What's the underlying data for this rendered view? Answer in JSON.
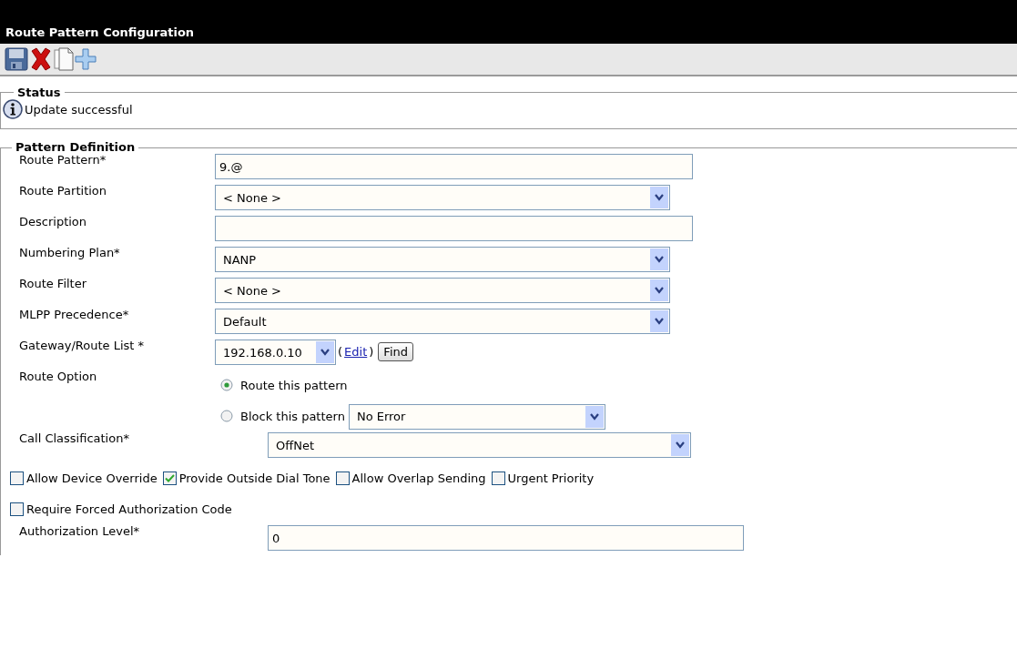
{
  "window": {
    "title": "Route Pattern Configuration"
  },
  "toolbar": [
    {
      "kind": "save"
    },
    {
      "kind": "delete"
    },
    {
      "kind": "copy"
    },
    {
      "kind": "add"
    }
  ],
  "status": {
    "legend": "Status",
    "message": "Update successful"
  },
  "pattern_definition": {
    "legend": "Pattern Definition",
    "rows": [
      {
        "kind": "text",
        "label": "Route Pattern*",
        "value": "9.@"
      },
      {
        "kind": "select",
        "label": "Route Partition",
        "value": "< None >"
      },
      {
        "kind": "text",
        "label": "Description"
      },
      {
        "kind": "select",
        "label": "Numbering Plan*",
        "value": "NANP"
      },
      {
        "kind": "select",
        "label": "Route Filter",
        "value": "< None >"
      },
      {
        "kind": "select",
        "label": "MLPP Precedence*",
        "value": "Default"
      },
      {
        "kind": "gateway",
        "label": "Gateway/Route List *",
        "value": "192.168.0.10",
        "paren_open": "(",
        "link": "Edit",
        "paren_close": ")",
        "button": "Find"
      },
      {
        "kind": "radio",
        "label": "Route Option",
        "options": [
          {
            "label": "Route this pattern",
            "selected": true
          },
          {
            "label": "Block this pattern",
            "selected": false,
            "select_value": "No Error"
          }
        ]
      },
      {
        "kind": "select_wide",
        "label": "Call Classification*",
        "value": "OffNet"
      },
      {
        "kind": "checks",
        "items": [
          {
            "label": "Allow Device Override",
            "checked": false
          },
          {
            "label": "Provide Outside Dial Tone",
            "checked": true
          },
          {
            "label": "Allow Overlap Sending",
            "checked": false
          },
          {
            "label": "Urgent Priority",
            "checked": false
          }
        ]
      },
      {
        "kind": "checks",
        "items": [
          {
            "label": "Require Forced Authorization Code",
            "checked": false
          }
        ]
      },
      {
        "kind": "text_wide",
        "label": "Authorization Level*",
        "value": "0"
      }
    ]
  }
}
